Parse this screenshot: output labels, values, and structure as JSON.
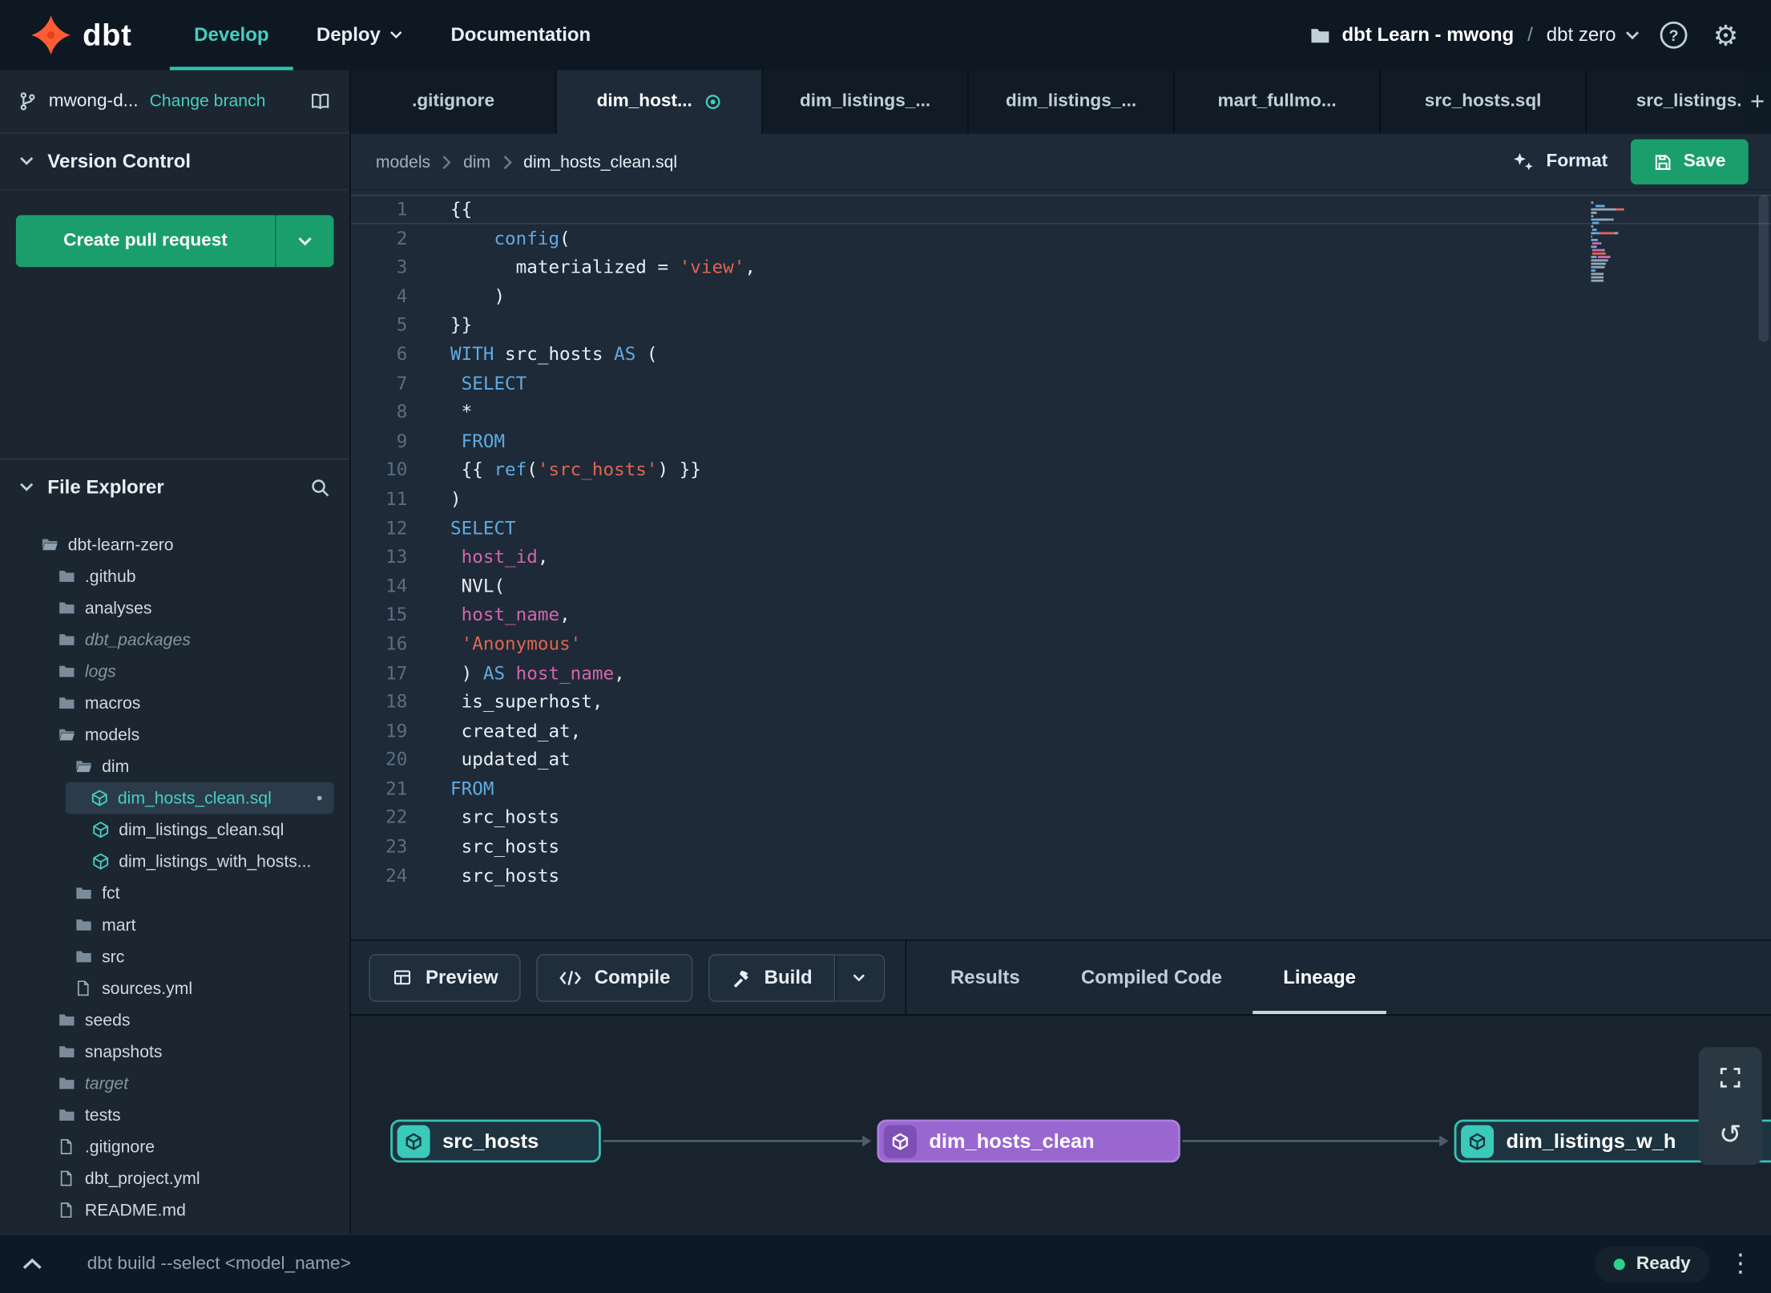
{
  "colors": {
    "accent_teal": "#45cfc0",
    "brand_orange": "#ff5c35",
    "button_green": "#1a9f6c",
    "node_purple": "#9a67d0",
    "status_green": "#2fd08a",
    "keyword_blue": "#61aae0",
    "string_red": "#e06550",
    "identifier_pink": "#d465ae"
  },
  "icons": {
    "gear-icon": "⚙",
    "kebab-icon": "⋮",
    "undo-icon": "↺",
    "help-icon": "?",
    "plus-icon": "+",
    "modified-dot": "•"
  },
  "nav": {
    "logo_text": "dbt",
    "items": [
      {
        "label": "Develop",
        "active": true,
        "caret": false
      },
      {
        "label": "Deploy",
        "active": false,
        "caret": true
      },
      {
        "label": "Documentation",
        "active": false,
        "caret": false
      }
    ],
    "project_name": "dbt Learn - mwong",
    "path_separator": "/",
    "environment": "dbt zero"
  },
  "sidebar": {
    "branch_name": "mwong-d...",
    "change_branch_label": "Change branch",
    "version_control_label": "Version Control",
    "create_pr_label": "Create pull request",
    "file_explorer_label": "File Explorer",
    "tree": [
      {
        "label": "dbt-learn-zero",
        "icon": "folder-open",
        "level": 0
      },
      {
        "label": ".github",
        "icon": "folder",
        "level": 1
      },
      {
        "label": "analyses",
        "icon": "folder",
        "level": 1
      },
      {
        "label": "dbt_packages",
        "icon": "folder",
        "level": 1,
        "muted": true
      },
      {
        "label": "logs",
        "icon": "folder",
        "level": 1,
        "muted": true
      },
      {
        "label": "macros",
        "icon": "folder",
        "level": 1
      },
      {
        "label": "models",
        "icon": "folder-open",
        "level": 1
      },
      {
        "label": "dim",
        "icon": "folder-open",
        "level": 2
      },
      {
        "label": "dim_hosts_clean.sql",
        "icon": "model",
        "level": 3,
        "selected": true,
        "modified": true
      },
      {
        "label": "dim_listings_clean.sql",
        "icon": "model",
        "level": 3
      },
      {
        "label": "dim_listings_with_hosts...",
        "icon": "model",
        "level": 3
      },
      {
        "label": "fct",
        "icon": "folder",
        "level": 2
      },
      {
        "label": "mart",
        "icon": "folder",
        "level": 2
      },
      {
        "label": "src",
        "icon": "folder",
        "level": 2
      },
      {
        "label": "sources.yml",
        "icon": "file",
        "level": 2
      },
      {
        "label": "seeds",
        "icon": "folder",
        "level": 1
      },
      {
        "label": "snapshots",
        "icon": "folder",
        "level": 1
      },
      {
        "label": "target",
        "icon": "folder",
        "level": 1,
        "muted": true
      },
      {
        "label": "tests",
        "icon": "folder",
        "level": 1
      },
      {
        "label": ".gitignore",
        "icon": "file",
        "level": 1
      },
      {
        "label": "dbt_project.yml",
        "icon": "file",
        "level": 1
      },
      {
        "label": "README.md",
        "icon": "file",
        "level": 1
      }
    ]
  },
  "editor": {
    "tabs": [
      {
        "label": ".gitignore"
      },
      {
        "label": "dim_host...",
        "active": true,
        "modified": true
      },
      {
        "label": "dim_listings_..."
      },
      {
        "label": "dim_listings_..."
      },
      {
        "label": "mart_fullmo..."
      },
      {
        "label": "src_hosts.sql"
      },
      {
        "label": "src_listings."
      }
    ],
    "new_tab_label": "+",
    "breadcrumb": [
      "models",
      "dim",
      "dim_hosts_clean.sql"
    ],
    "format_label": "Format",
    "save_label": "Save",
    "code_lines": [
      {
        "n": 1,
        "current": true,
        "seg": [
          [
            "p",
            "{{"
          ]
        ]
      },
      {
        "n": 2,
        "seg": [
          [
            "p",
            "    "
          ],
          [
            "k",
            "config"
          ],
          [
            "p",
            "("
          ]
        ]
      },
      {
        "n": 3,
        "seg": [
          [
            "p",
            "      materialized = "
          ],
          [
            "s",
            "'view'"
          ],
          [
            "p",
            ","
          ]
        ]
      },
      {
        "n": 4,
        "seg": [
          [
            "p",
            "    )"
          ]
        ]
      },
      {
        "n": 5,
        "seg": [
          [
            "p",
            "}}"
          ]
        ]
      },
      {
        "n": 6,
        "seg": [
          [
            "k",
            "WITH"
          ],
          [
            "p",
            " src_hosts "
          ],
          [
            "k",
            "AS"
          ],
          [
            "p",
            " ("
          ]
        ]
      },
      {
        "n": 7,
        "seg": [
          [
            "p",
            " "
          ],
          [
            "k",
            "SELECT"
          ]
        ]
      },
      {
        "n": 8,
        "seg": [
          [
            "p",
            " *"
          ]
        ]
      },
      {
        "n": 9,
        "seg": [
          [
            "p",
            " "
          ],
          [
            "k",
            "FROM"
          ]
        ]
      },
      {
        "n": 10,
        "seg": [
          [
            "p",
            " {{ "
          ],
          [
            "k",
            "ref"
          ],
          [
            "p",
            "("
          ],
          [
            "s",
            "'src_hosts'"
          ],
          [
            "p",
            ") }}"
          ]
        ]
      },
      {
        "n": 11,
        "seg": [
          [
            "p",
            ")"
          ]
        ]
      },
      {
        "n": 12,
        "seg": [
          [
            "k",
            "SELECT"
          ]
        ]
      },
      {
        "n": 13,
        "seg": [
          [
            "p",
            " "
          ],
          [
            "i",
            "host_id"
          ],
          [
            "p",
            ","
          ]
        ]
      },
      {
        "n": 14,
        "seg": [
          [
            "p",
            " NVL("
          ]
        ]
      },
      {
        "n": 15,
        "seg": [
          [
            "p",
            " "
          ],
          [
            "i",
            "host_name"
          ],
          [
            "p",
            ","
          ]
        ]
      },
      {
        "n": 16,
        "seg": [
          [
            "p",
            " "
          ],
          [
            "s",
            "'Anonymous'"
          ]
        ]
      },
      {
        "n": 17,
        "seg": [
          [
            "p",
            " ) "
          ],
          [
            "k",
            "AS"
          ],
          [
            "p",
            " "
          ],
          [
            "i",
            "host_name"
          ],
          [
            "p",
            ","
          ]
        ]
      },
      {
        "n": 18,
        "seg": [
          [
            "p",
            " is_superhost,"
          ]
        ]
      },
      {
        "n": 19,
        "seg": [
          [
            "p",
            " created_at,"
          ]
        ]
      },
      {
        "n": 20,
        "seg": [
          [
            "p",
            " updated_at"
          ]
        ]
      },
      {
        "n": 21,
        "seg": [
          [
            "k",
            "FROM"
          ]
        ]
      },
      {
        "n": 22,
        "seg": [
          [
            "p",
            " src_hosts"
          ]
        ]
      },
      {
        "n": 23,
        "seg": [
          [
            "p",
            " src_hosts"
          ]
        ]
      },
      {
        "n": 24,
        "seg": [
          [
            "p",
            " src_hosts"
          ]
        ]
      }
    ]
  },
  "bottom_panel": {
    "buttons": [
      {
        "label": "Preview",
        "icon": "table-icon"
      },
      {
        "label": "Compile",
        "icon": "code-icon"
      },
      {
        "label": "Build",
        "icon": "hammer-icon",
        "split": true
      }
    ],
    "tabs": [
      {
        "label": "Results"
      },
      {
        "label": "Compiled Code"
      },
      {
        "label": "Lineage",
        "active": true
      }
    ],
    "lineage": {
      "nodes": [
        {
          "label": "src_hosts",
          "style": "teal"
        },
        {
          "label": "dim_hosts_clean",
          "style": "purple"
        },
        {
          "label": "dim_listings_w_h",
          "style": "teal"
        }
      ]
    }
  },
  "command_bar": {
    "command": "dbt build --select <model_name>",
    "status": "Ready"
  }
}
